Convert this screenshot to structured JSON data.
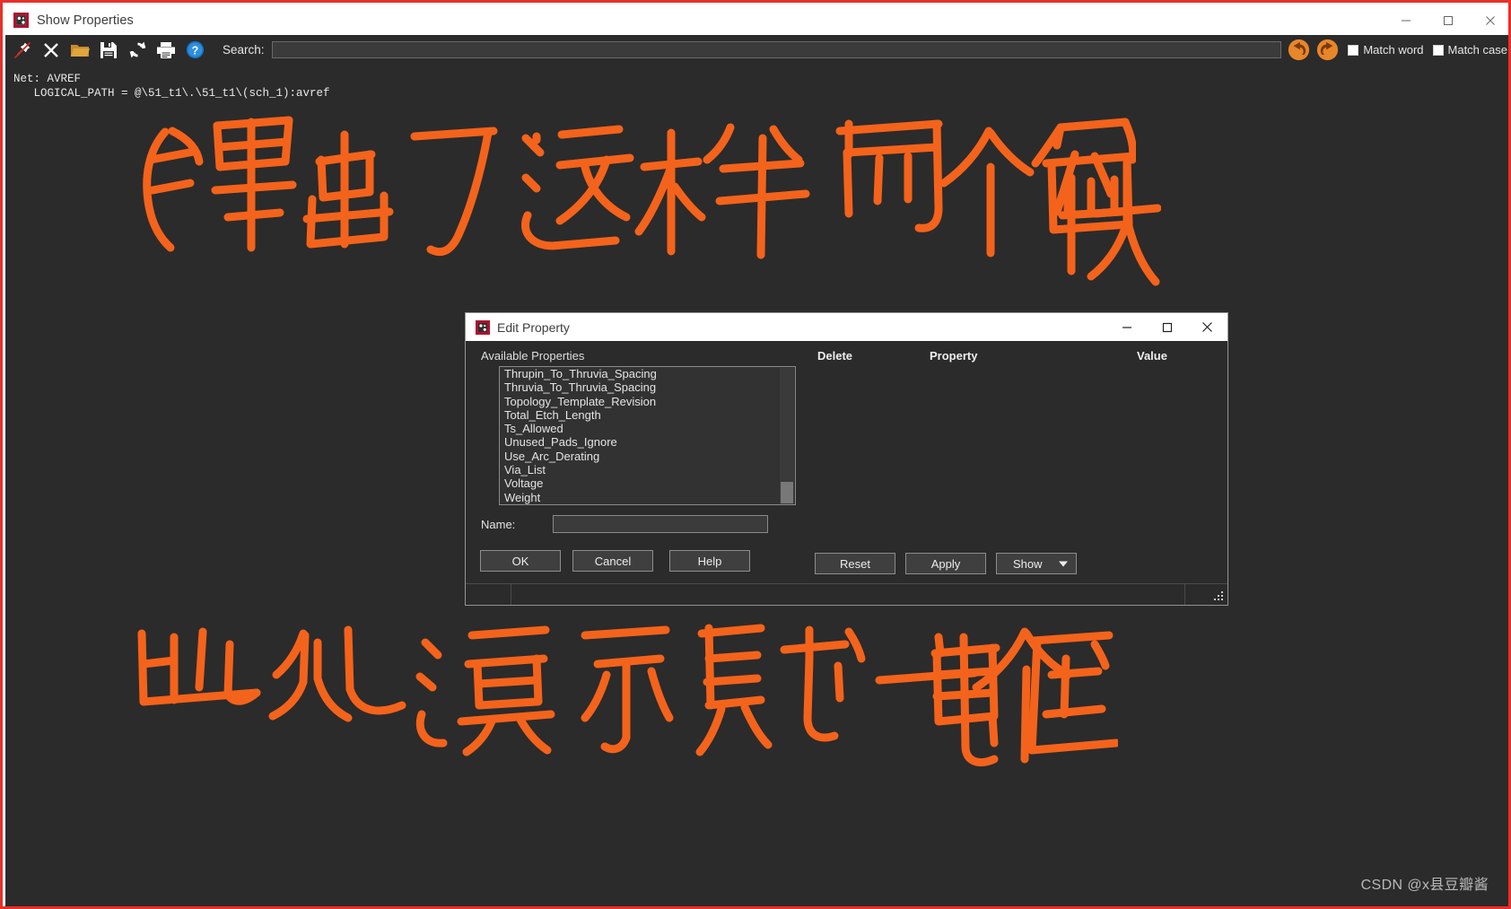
{
  "main_window": {
    "title": "Show Properties",
    "icon": "app-properties-icon",
    "window_buttons": {
      "minimize": "minimize-icon",
      "maximize": "maximize-icon",
      "close": "close-icon"
    }
  },
  "toolbar": {
    "icons": [
      {
        "name": "pin-disabled-icon",
        "tooltip": "Pin"
      },
      {
        "name": "close-x-icon",
        "tooltip": "Close"
      },
      {
        "name": "folder-open-icon",
        "tooltip": "Open"
      },
      {
        "name": "save-floppy-icon",
        "tooltip": "Save"
      },
      {
        "name": "refresh-icon",
        "tooltip": "Refresh"
      },
      {
        "name": "print-icon",
        "tooltip": "Print"
      },
      {
        "name": "help-icon",
        "tooltip": "Help"
      }
    ],
    "search_label": "Search:",
    "search_value": "",
    "search_placeholder": "",
    "nav_back": "back-arrow-icon",
    "nav_forward": "forward-arrow-icon",
    "match_word_label": "Match word",
    "match_word_checked": false,
    "match_case_label": "Match case",
    "match_case_checked": false
  },
  "content": {
    "net_text": "Net: AVREF\n   LOGICAL_PATH = @\\51_t1\\.\\51_t1\\(sch_1):avref"
  },
  "annotations": {
    "top_note": "弹出了这样两个窗体",
    "bottom_note": "此处演示赋一个电压",
    "arrow_target": "Voltage",
    "color": "#f4631b"
  },
  "dialog": {
    "title": "Edit Property",
    "icon": "app-properties-icon",
    "window_buttons": {
      "minimize": "minimize-icon",
      "maximize": "maximize-icon",
      "close": "close-icon"
    },
    "available_properties_label": "Available Properties",
    "available_properties": [
      "Thrupin_To_Thruvia_Spacing",
      "Thruvia_To_Thruvia_Spacing",
      "Topology_Template_Revision",
      "Total_Etch_Length",
      "Ts_Allowed",
      "Unused_Pads_Ignore",
      "Use_Arc_Derating",
      "Via_List",
      "Voltage",
      "Weight"
    ],
    "columns": {
      "delete": "Delete",
      "property": "Property",
      "value": "Value"
    },
    "name_label": "Name:",
    "name_value": "",
    "name_placeholder": "",
    "buttons": {
      "ok": "OK",
      "cancel": "Cancel",
      "help": "Help",
      "reset": "Reset",
      "apply": "Apply",
      "show": "Show"
    }
  },
  "watermark": "CSDN @x县豆瓣酱",
  "colors": {
    "accent_red": "#e8302a",
    "annotation_orange": "#f4631b",
    "dark_bg": "#2b2b2b",
    "toolbar_bg": "#2b2b2b",
    "nav_orange": "#e8862a"
  }
}
